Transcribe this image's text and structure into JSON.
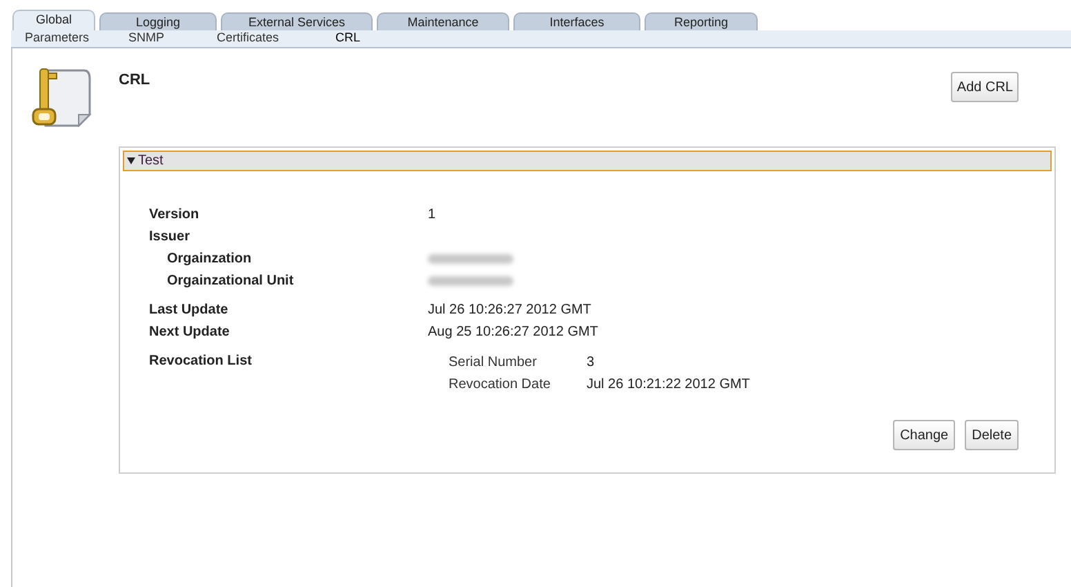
{
  "tabs": [
    {
      "label": "Global",
      "selected": true
    },
    {
      "label": "Logging",
      "selected": false
    },
    {
      "label": "External Services",
      "selected": false
    },
    {
      "label": "Maintenance",
      "selected": false
    },
    {
      "label": "Interfaces",
      "selected": false
    },
    {
      "label": "Reporting",
      "selected": false
    }
  ],
  "subtabs": [
    {
      "label": "Parameters",
      "selected": false
    },
    {
      "label": "SNMP",
      "selected": false
    },
    {
      "label": "Certificates",
      "selected": false
    },
    {
      "label": "CRL",
      "selected": true
    }
  ],
  "page_title": "CRL",
  "add_button": "Add CRL",
  "section": {
    "title": "Test",
    "expanded": true,
    "rows": [
      {
        "label": "Version",
        "value": "1",
        "indented": false
      },
      {
        "label": "Issuer",
        "indented": false
      },
      {
        "label": "Orgainzation",
        "kind": "redacted",
        "indented": true
      },
      {
        "label": "Orgainzational Unit",
        "kind": "redacted",
        "indented": true
      },
      {
        "label": "Last Update",
        "value": "Jul 26 10:26:27 2012 GMT",
        "indented": false
      },
      {
        "label": "Next Update",
        "value": "Aug 25 10:26:27 2012 GMT",
        "indented": false
      },
      {
        "label": "Revocation List",
        "indented": false,
        "entries": [
          {
            "label": "Serial Number",
            "value": "3"
          },
          {
            "label": "Revocation Date",
            "value": "Jul 26 10:21:22 2012 GMT"
          }
        ]
      }
    ],
    "buttons": [
      "Change",
      "Delete"
    ]
  }
}
